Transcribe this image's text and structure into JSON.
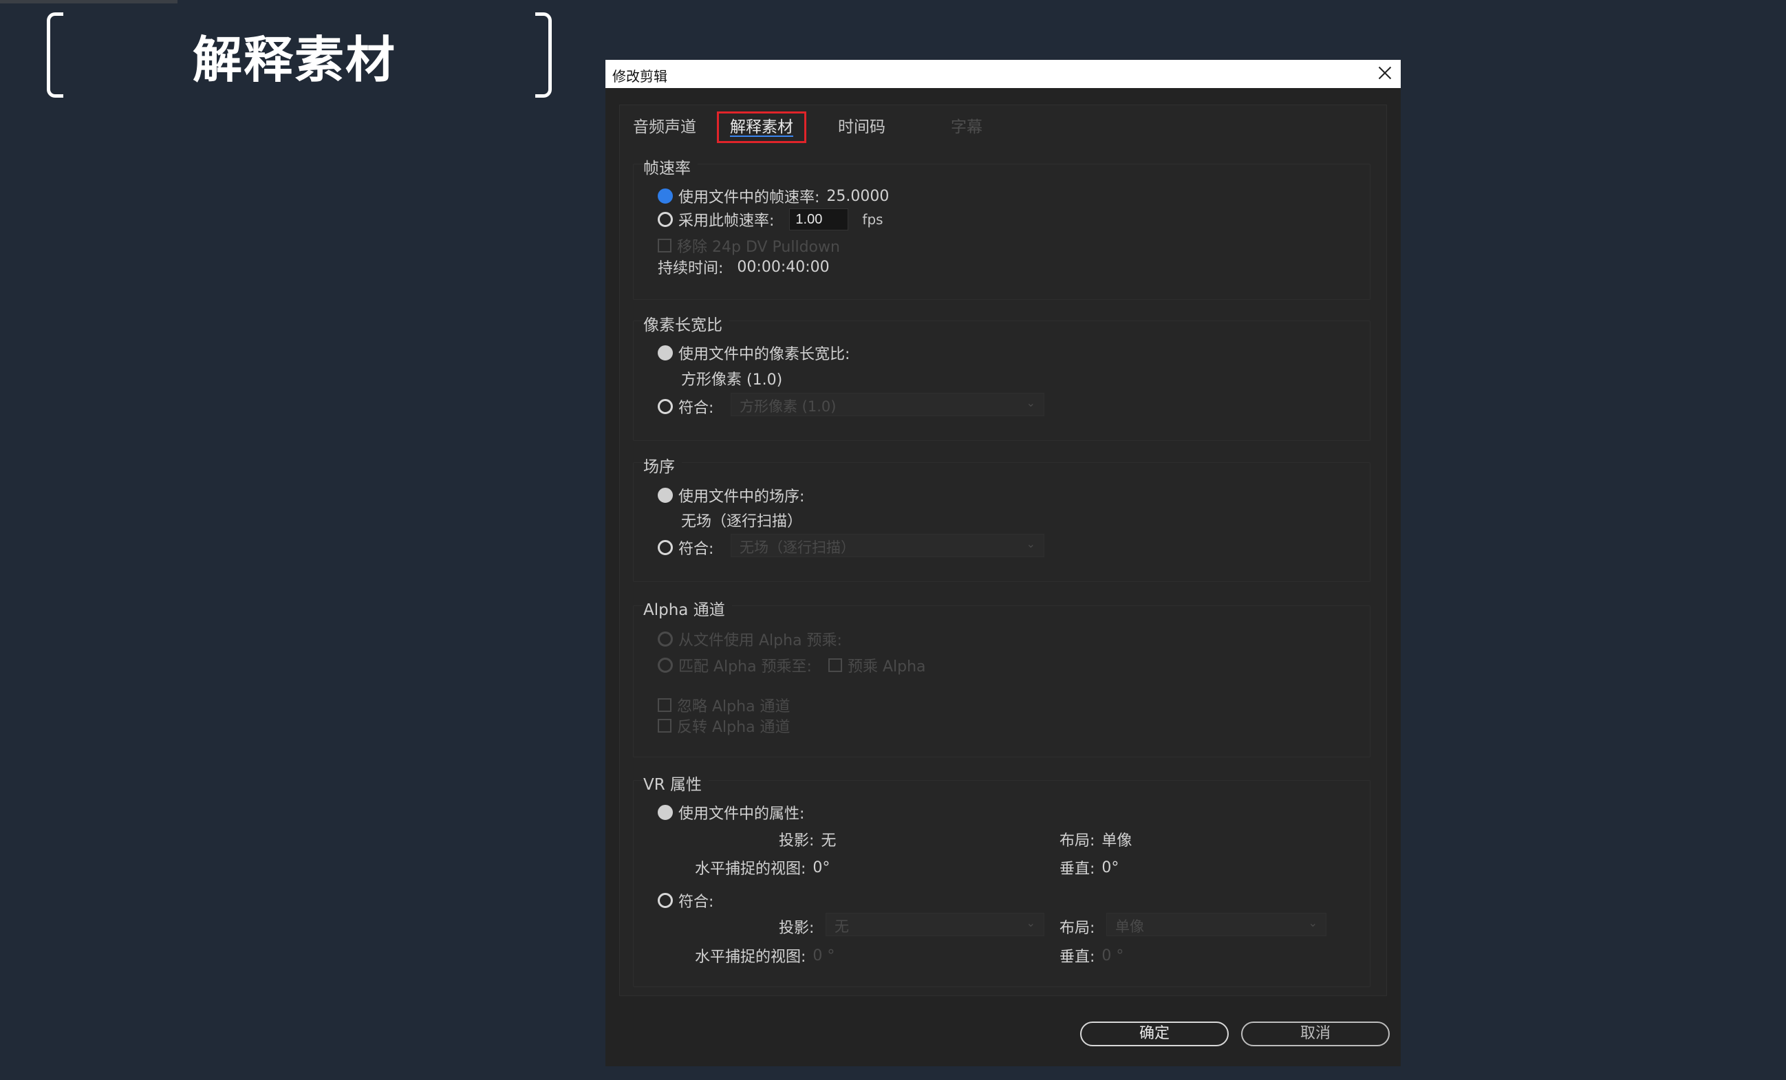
{
  "heading": "解释素材",
  "dialog": {
    "title": "修改剪辑",
    "tabs": [
      {
        "label": "音频声道"
      },
      {
        "label": "解释素材"
      },
      {
        "label": "时间码"
      },
      {
        "label": "字幕"
      }
    ],
    "framerate": {
      "title": "帧速率",
      "use_file": "使用文件中的帧速率:",
      "file_rate": "25.0000",
      "assume": "采用此帧速率:",
      "assume_value": "1.00",
      "unit": "fps",
      "pulldown": "移除 24p DV Pulldown",
      "duration_label": "持续时间:",
      "duration_value": "00:00:40:00"
    },
    "pixel_aspect": {
      "title": "像素长宽比",
      "use_file": "使用文件中的像素长宽比:",
      "file_value": "方形像素 (1.0)",
      "conform": "符合:",
      "conform_value": "方形像素 (1.0)"
    },
    "field_order": {
      "title": "场序",
      "use_file": "使用文件中的场序:",
      "file_value": "无场（逐行扫描）",
      "conform": "符合:",
      "conform_value": "无场（逐行扫描）"
    },
    "alpha": {
      "title": "Alpha 通道",
      "from_file": "从文件使用 Alpha 预乘:",
      "match": "匹配 Alpha 预乘至:",
      "premultiply": "预乘 Alpha",
      "ignore": "忽略 Alpha 通道",
      "invert": "反转 Alpha 通道"
    },
    "vr": {
      "title": "VR 属性",
      "use_file": "使用文件中的属性:",
      "projection_label": "投影:",
      "projection_value": "无",
      "layout_label": "布局:",
      "layout_value": "单像",
      "hview_label": "水平捕捉的视图:",
      "hview_value": "0°",
      "vertical_label": "垂直:",
      "vertical_value": "0°",
      "conform": "符合:",
      "conform_projection": "无",
      "conform_layout": "单像",
      "conform_hview": "0 °",
      "conform_vertical": "0 °"
    },
    "ok": "确定",
    "cancel": "取消"
  }
}
